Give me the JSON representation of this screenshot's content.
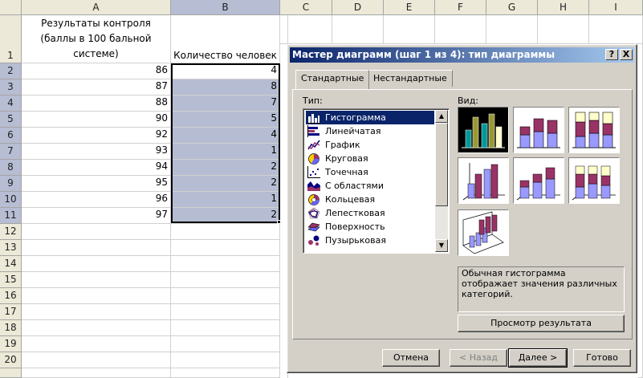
{
  "sheet": {
    "columns": [
      "A",
      "B",
      "C",
      "D",
      "E",
      "F",
      "G",
      "H",
      "I"
    ],
    "header_text_a": [
      "Результаты контроля",
      "(баллы в 100 бальной",
      "системе)"
    ],
    "header_text_b": "Количество человек",
    "rows": [
      "1",
      "2",
      "3",
      "4",
      "5",
      "6",
      "7",
      "8",
      "9",
      "10",
      "11",
      "12",
      "13",
      "14",
      "15",
      "16",
      "17",
      "18",
      "19",
      "20"
    ],
    "data": [
      {
        "a": "86",
        "b": "4"
      },
      {
        "a": "87",
        "b": "8"
      },
      {
        "a": "88",
        "b": "7"
      },
      {
        "a": "90",
        "b": "5"
      },
      {
        "a": "92",
        "b": "4"
      },
      {
        "a": "93",
        "b": "1"
      },
      {
        "a": "94",
        "b": "2"
      },
      {
        "a": "95",
        "b": "2"
      },
      {
        "a": "96",
        "b": "1"
      },
      {
        "a": "97",
        "b": "2"
      }
    ]
  },
  "dialog": {
    "title": "Мастер диаграмм (шаг 1 из 4): тип диаграммы",
    "help_btn": "?",
    "close_btn": "X",
    "tabs": [
      "Стандартные",
      "Нестандартные"
    ],
    "type_label": "Тип:",
    "view_label": "Вид:",
    "types": [
      {
        "label": "Гистограмма",
        "icon": "column-chart-icon"
      },
      {
        "label": "Линейчатая",
        "icon": "bar-chart-icon"
      },
      {
        "label": "График",
        "icon": "line-chart-icon"
      },
      {
        "label": "Круговая",
        "icon": "pie-chart-icon"
      },
      {
        "label": "Точечная",
        "icon": "scatter-chart-icon"
      },
      {
        "label": "С областями",
        "icon": "area-chart-icon"
      },
      {
        "label": "Кольцевая",
        "icon": "doughnut-chart-icon"
      },
      {
        "label": "Лепестковая",
        "icon": "radar-chart-icon"
      },
      {
        "label": "Поверхность",
        "icon": "surface-chart-icon"
      },
      {
        "label": "Пузырьковая",
        "icon": "bubble-chart-icon"
      }
    ],
    "description": "Обычная гистограмма отображает значения различных категорий.",
    "preview_btn": "Просмотр результата",
    "cancel_btn": "Отмена",
    "back_btn": "< Назад",
    "next_btn": "Далее >",
    "finish_btn": "Готово"
  },
  "colors": {
    "title_start": "#0a246a",
    "title_end": "#a6caf0",
    "selection": "#b6bdd2",
    "chart_purple": "#993366",
    "chart_blue": "#9999ff",
    "chart_yellow": "#ffffcc",
    "chart_teal": "#009999"
  }
}
